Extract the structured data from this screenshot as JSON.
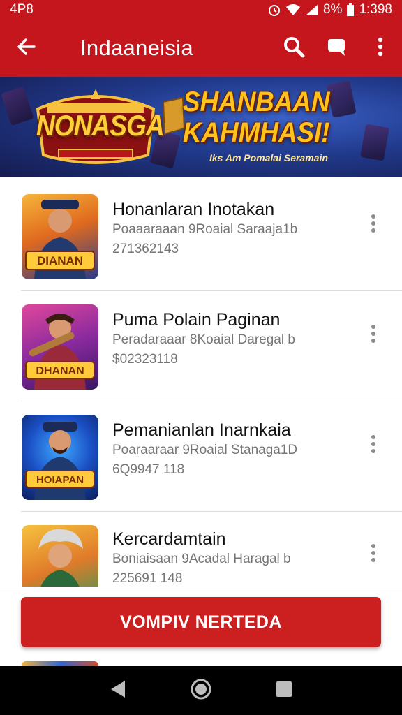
{
  "status_bar": {
    "left_text": "4P8",
    "battery_text": "8%",
    "time": "1:398"
  },
  "app_bar": {
    "title": "Indaaneisia"
  },
  "banner": {
    "logo_text": "NONASGA",
    "headline_line1": "SHANBAAN",
    "headline_line2": "KAHMHASI!",
    "subtitle": "Iks Am Pomalai Seramain"
  },
  "items": [
    {
      "title": "Honanlaran Inotakan",
      "subtitle": "Poaaaraaan 9Roaial Saraaja1b",
      "number": "271362143",
      "badge": "DIANAN",
      "colors": [
        "#f2a327",
        "#1f3f85"
      ]
    },
    {
      "title": "Puma Polain Paginan",
      "subtitle": "Peradaraaar 8Koaial Daregal b",
      "number": "$02323118",
      "badge": "DHANAN",
      "colors": [
        "#c1246b",
        "#3e1a6e"
      ]
    },
    {
      "title": "Pemanianlan Inarnkaia",
      "subtitle": "Poaraaraar 9Roaial Stanaga1D",
      "number": "6Q9947 118",
      "badge": "HOIAPAN",
      "colors": [
        "#1e6fe0",
        "#12245e"
      ]
    },
    {
      "title": "Kercardamtain",
      "subtitle": "Boniaisaan 9Acadal Haragal b",
      "number": "225691 148",
      "badge": "",
      "colors": [
        "#f1a92b",
        "#2a9a5a"
      ]
    }
  ],
  "cta": {
    "label": "VOMPIV NERTEDA"
  },
  "icons": {
    "back": "arrow-back-icon",
    "search": "search-icon",
    "chat": "chat-icon",
    "more": "more-vert-icon",
    "nav_back": "triangle-back-icon",
    "nav_home": "circle-home-icon",
    "nav_recent": "square-recent-icon"
  },
  "colors": {
    "primary": "#c4161c",
    "cta": "#cc1f1f",
    "text": "#111111",
    "subtext": "#757575"
  }
}
